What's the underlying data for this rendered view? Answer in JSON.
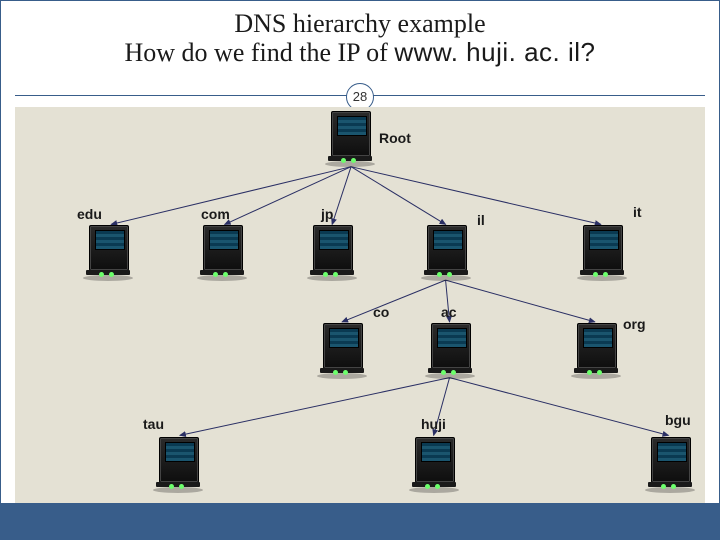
{
  "title": {
    "line1": "DNS hierarchy example",
    "line2a": "How do we find the IP of ",
    "line2b": "www. huji. ac. il?"
  },
  "slide_number": "28",
  "labels": {
    "root": "Root",
    "edu": "edu",
    "com": "com",
    "jp": "jp",
    "il": "il",
    "it": "it",
    "co": "co",
    "ac": "ac",
    "org": "org",
    "tau": "tau",
    "huji": "huji",
    "bgu": "bgu"
  },
  "tree": {
    "root": {
      "children": [
        "edu",
        "com",
        "jp",
        "il",
        "it"
      ]
    },
    "il": {
      "children": [
        "co",
        "ac",
        "org"
      ]
    },
    "ac": {
      "children": [
        "tau",
        "huji",
        "bgu"
      ]
    }
  }
}
